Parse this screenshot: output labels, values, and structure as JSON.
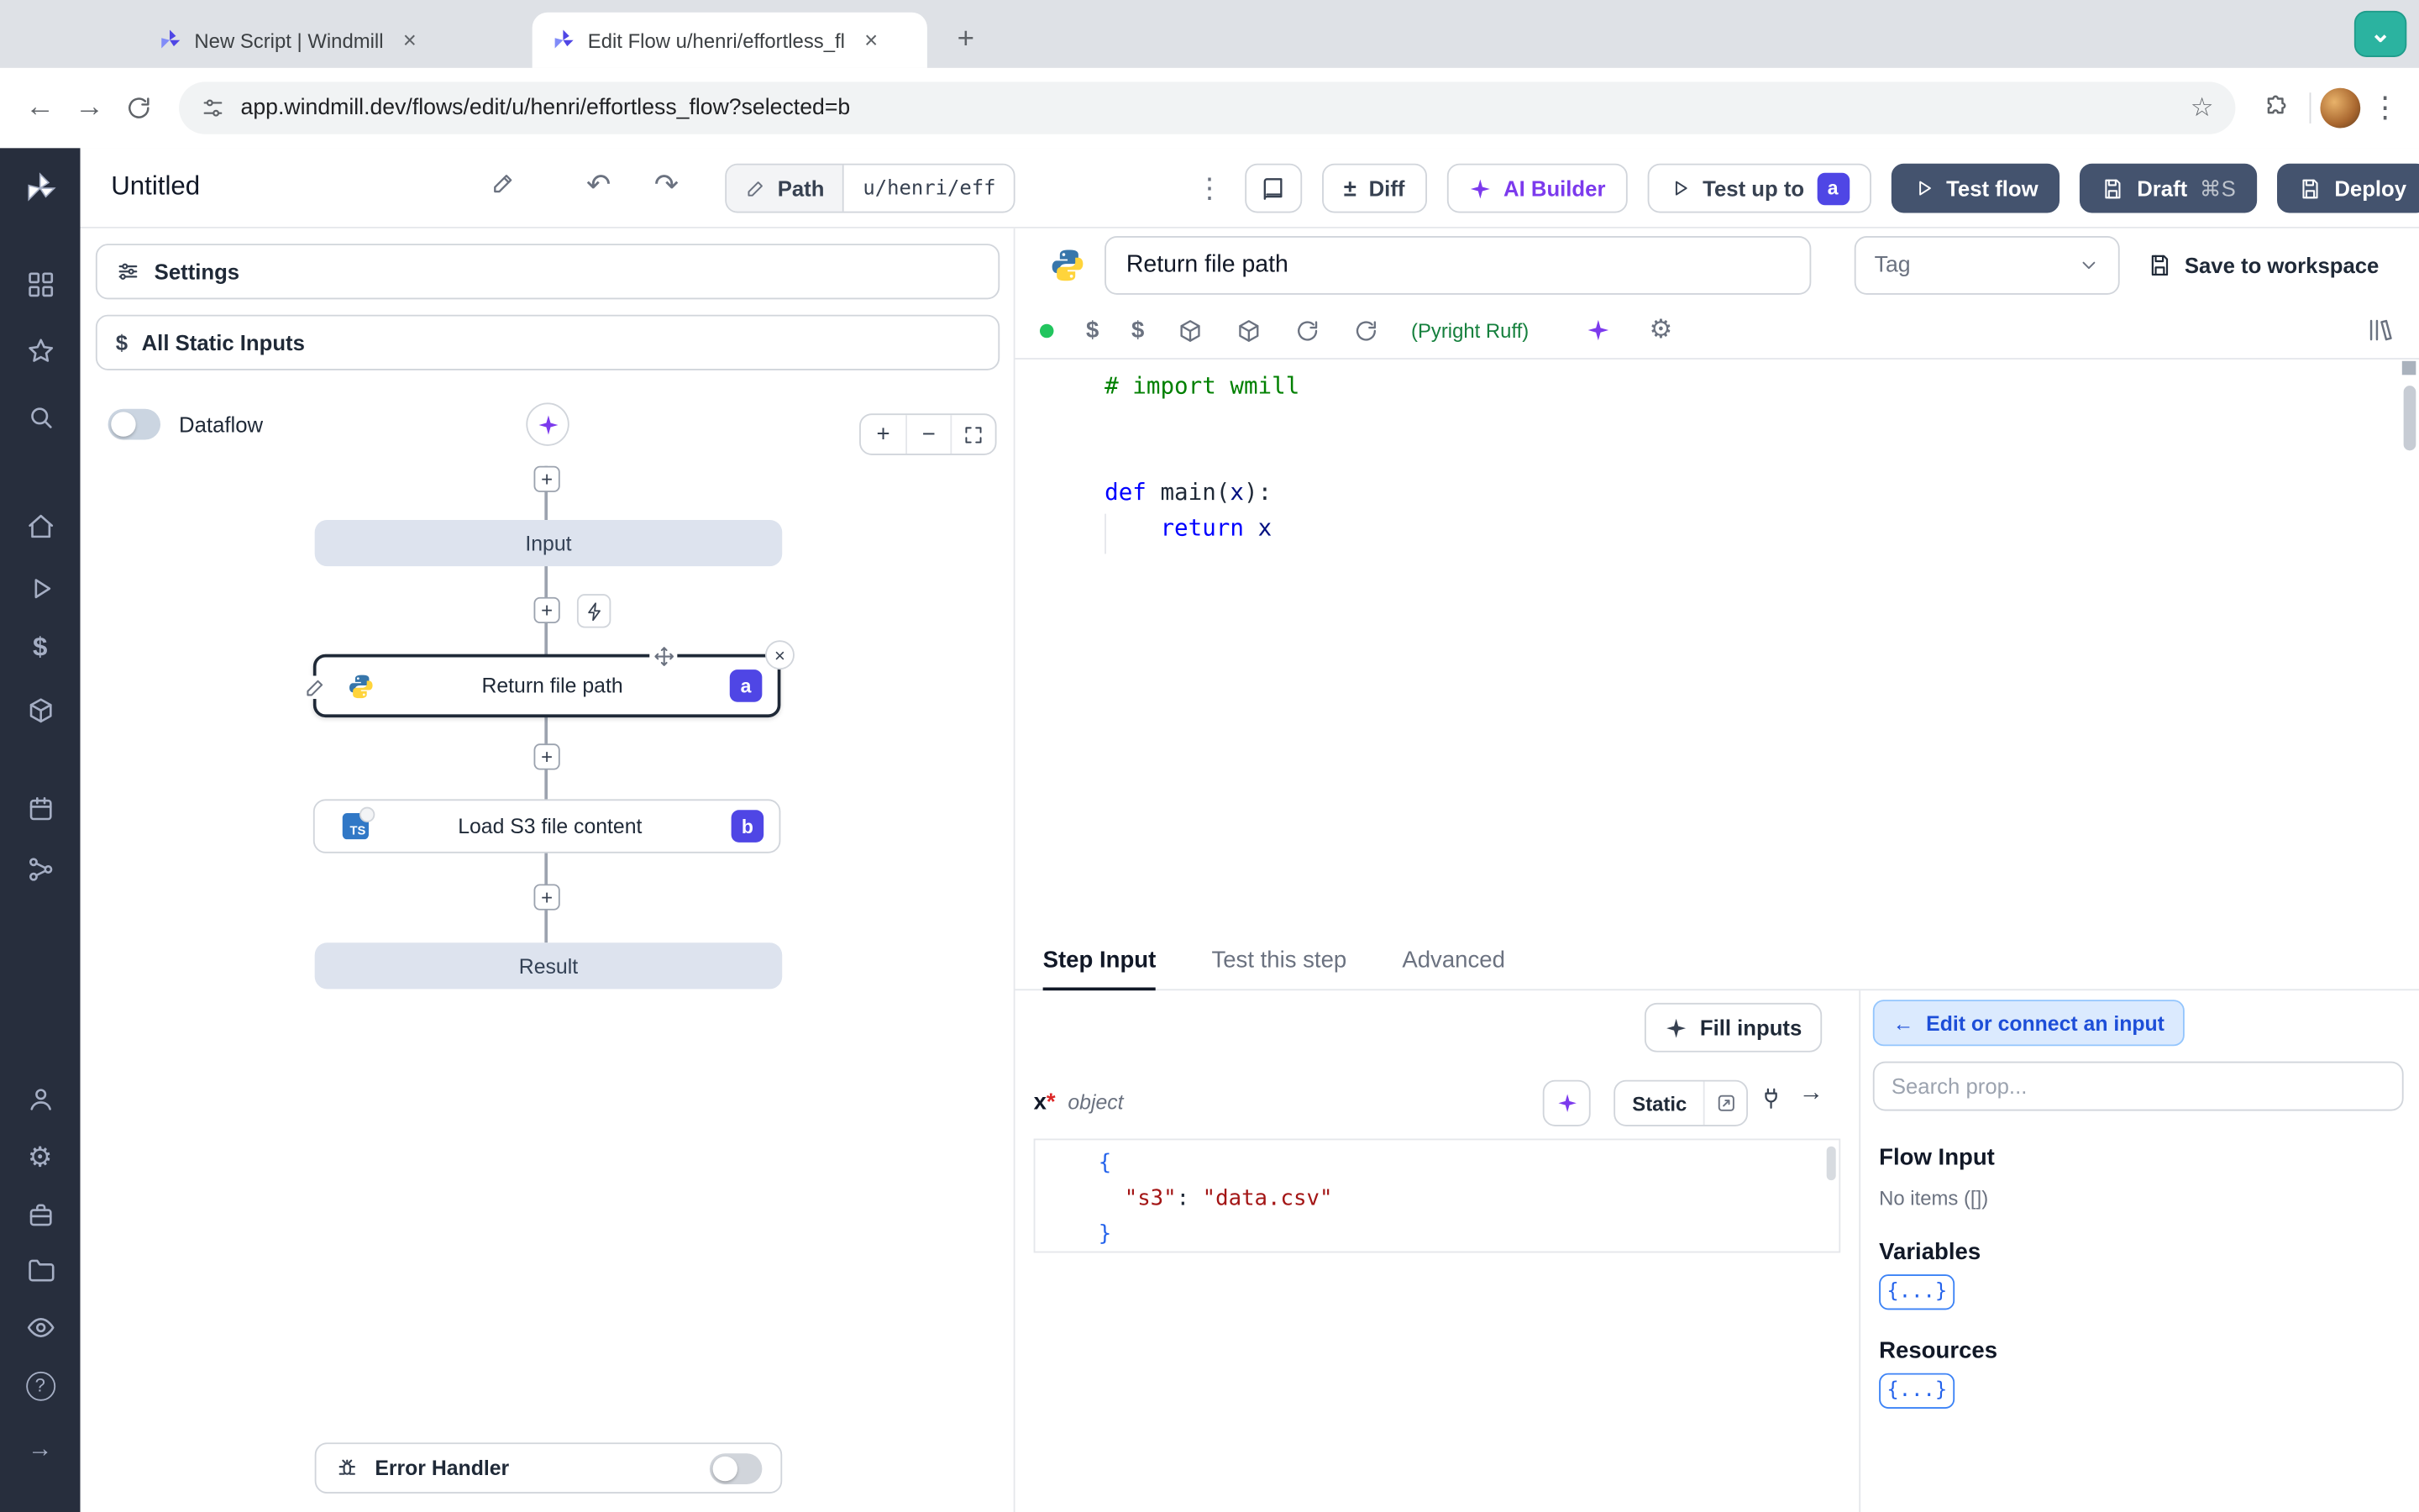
{
  "browser": {
    "tab1": "New Script | Windmill",
    "tab2": "Edit Flow u/henri/effortless_fl",
    "url": "app.windmill.dev/flows/edit/u/henri/effortless_flow?selected=b"
  },
  "icons": {
    "close": "×",
    "new_tab": "+",
    "chevron_down": "⌄",
    "back": "←",
    "forward": "→",
    "star": "☆",
    "kebab": "⋮",
    "undo": "↶",
    "redo": "↷",
    "plusminus": "±",
    "plus": "+",
    "minus": "−",
    "gear": "⚙",
    "question": "?",
    "arrow_right": "→",
    "arrow_left": "←",
    "dollar": "$",
    "ts": "TS"
  },
  "header": {
    "title": "Untitled",
    "path_label": "Path",
    "path_value": "u/henri/eff",
    "diff": "Diff",
    "ai_builder": "AI Builder",
    "test_up_to": "Test up to",
    "test_up_to_badge": "a",
    "test_flow": "Test flow",
    "draft": "Draft",
    "draft_shortcut": "⌘S",
    "deploy": "Deploy"
  },
  "flow_panel": {
    "settings": "Settings",
    "all_static_inputs": "All Static Inputs",
    "dataflow": "Dataflow",
    "input_node": "Input",
    "step_a_label": "Return file path",
    "step_a_badge": "a",
    "step_b_label": "Load S3 file content",
    "step_b_badge": "b",
    "result_node": "Result",
    "error_handler": "Error Handler"
  },
  "editor": {
    "step_name": "Return file path",
    "tag_placeholder": "Tag",
    "save_to_workspace": "Save to workspace",
    "lint": "(Pyright Ruff)",
    "code": {
      "comment": "# import wmill",
      "kw_def": "def ",
      "fn": "main",
      "p1": "(",
      "param": "x",
      "p2": "):",
      "indent": "    ",
      "kw_return": "return ",
      "ret_var": "x"
    }
  },
  "step_panel": {
    "tabs": [
      "Step Input",
      "Test this step",
      "Advanced"
    ],
    "fill_inputs": "Fill inputs",
    "arg_name": "x",
    "arg_required": "*",
    "arg_type": "object",
    "static_label": "Static",
    "json": {
      "open": "{",
      "indent": "  ",
      "key": "\"s3\"",
      "colon": ": ",
      "value": "\"data.csv\"",
      "close": "}"
    }
  },
  "connect_panel": {
    "edit_or_connect": "Edit or connect an input",
    "search_placeholder": "Search prop...",
    "flow_input": "Flow Input",
    "no_items": "No items ([])",
    "variables": "Variables",
    "resources": "Resources",
    "braces": "{...}"
  },
  "colors": {
    "accent_indigo": "#4f46e5",
    "ai_violet": "#7c3aed",
    "dark_button": "#44536e",
    "status_green": "#22c55e",
    "capture_teal": "#2bb3a0"
  }
}
